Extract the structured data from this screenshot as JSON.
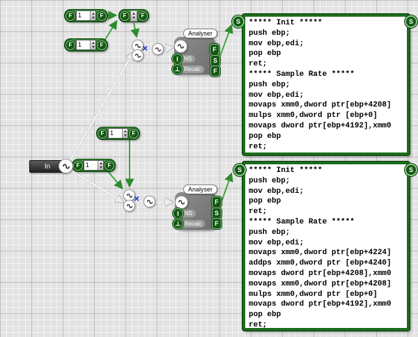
{
  "float_nodes": [
    {
      "left_port": "F",
      "value": "1",
      "right_port": "F"
    },
    {
      "left_port": "F",
      "value": "1",
      "right_port": "F"
    },
    {
      "left_port": "F",
      "value": "1",
      "right_port": "F"
    },
    {
      "left_port": "F",
      "value": "1",
      "right_port": "F"
    }
  ],
  "combiner": {
    "left_port": "F",
    "right_port": "F"
  },
  "in_node": {
    "label": "In"
  },
  "multiply_nodes": [
    {
      "operator": "×"
    },
    {
      "operator": "×"
    }
  ],
  "analysers": [
    {
      "title": "Analyser",
      "input_ports": [
        {
          "letter": "I",
          "label": "NS"
        },
        {
          "label": "Recalc"
        }
      ],
      "output_ports": [
        "F",
        "S",
        "F"
      ]
    },
    {
      "title": "Analyser",
      "input_ports": [
        {
          "letter": "I",
          "label": "NS"
        },
        {
          "label": "Recalc"
        }
      ],
      "output_ports": [
        "F",
        "S",
        "F"
      ]
    }
  ],
  "code_boxes": [
    {
      "connector": "S",
      "code": "***** Init *****\npush ebp;\nmov ebp,edi;\npop ebp\nret;\n***** Sample Rate *****\npush ebp;\nmov ebp,edi;\nmovaps xmm0,dword ptr[ebp+4208]\nmulps xmm0,dword ptr [ebp+0]\nmovaps dword ptr[ebp+4192],xmm0\npop ebp\nret;"
    },
    {
      "connector": "S",
      "code": "***** Init *****\npush ebp;\nmov ebp,edi;\npop ebp\nret;\n***** Sample Rate *****\npush ebp;\nmov ebp,edi;\nmovaps xmm0,dword ptr[ebp+4224]\naddps xmm0,dword ptr [ebp+4240]\nmovaps dword ptr[ebp+4208],xmm0\nmovaps xmm0,dword ptr[ebp+4208]\nmulps xmm0,dword ptr [ebp+0]\nmovaps dword ptr[ebp+4192],xmm0\npop ebp\nret;"
    }
  ],
  "colors": {
    "node_green": "#1e6b1e",
    "port_ring_green": "#9ccd9c",
    "wire_green": "#3fa53f",
    "wire_white": "#f8f8f8",
    "multiply_blue": "#2233cc",
    "analyser_gray": "#7a7a7a",
    "codebox_border": "#1c6b1c"
  }
}
